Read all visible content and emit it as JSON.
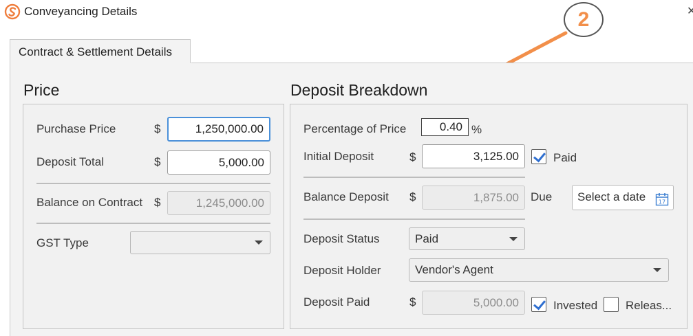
{
  "window": {
    "title": "Conveyancing Details",
    "close_glyph": "✕"
  },
  "tabs": [
    {
      "label": "Contract & Settlement Details",
      "active": true
    }
  ],
  "price": {
    "heading": "Price",
    "currency": "$",
    "purchase_price": {
      "label": "Purchase Price",
      "value": "1,250,000.00"
    },
    "deposit_total": {
      "label": "Deposit Total",
      "value": "5,000.00"
    },
    "balance_on_contract": {
      "label": "Balance on Contract",
      "value": "1,245,000.00"
    },
    "gst_type": {
      "label": "GST Type",
      "value": ""
    }
  },
  "deposit": {
    "heading": "Deposit Breakdown",
    "currency": "$",
    "percentage_of_price": {
      "label": "Percentage of Price",
      "value": "0.40",
      "unit": "%"
    },
    "initial_deposit": {
      "label": "Initial Deposit",
      "value": "3,125.00",
      "paid_label": "Paid",
      "paid_checked": true
    },
    "balance_deposit": {
      "label": "Balance Deposit",
      "value": "1,875.00",
      "due_label": "Due",
      "date_placeholder": "Select a date",
      "calendar_day": "17"
    },
    "deposit_status": {
      "label": "Deposit Status",
      "value": "Paid"
    },
    "deposit_holder": {
      "label": "Deposit Holder",
      "value": "Vendor's Agent"
    },
    "deposit_paid": {
      "label": "Deposit Paid",
      "value": "5,000.00",
      "invested_label": "Invested",
      "invested_checked": true,
      "released_label": "Releas...",
      "released_checked": false
    }
  },
  "annotation": {
    "badge": "2",
    "color": "#f28f4a"
  }
}
